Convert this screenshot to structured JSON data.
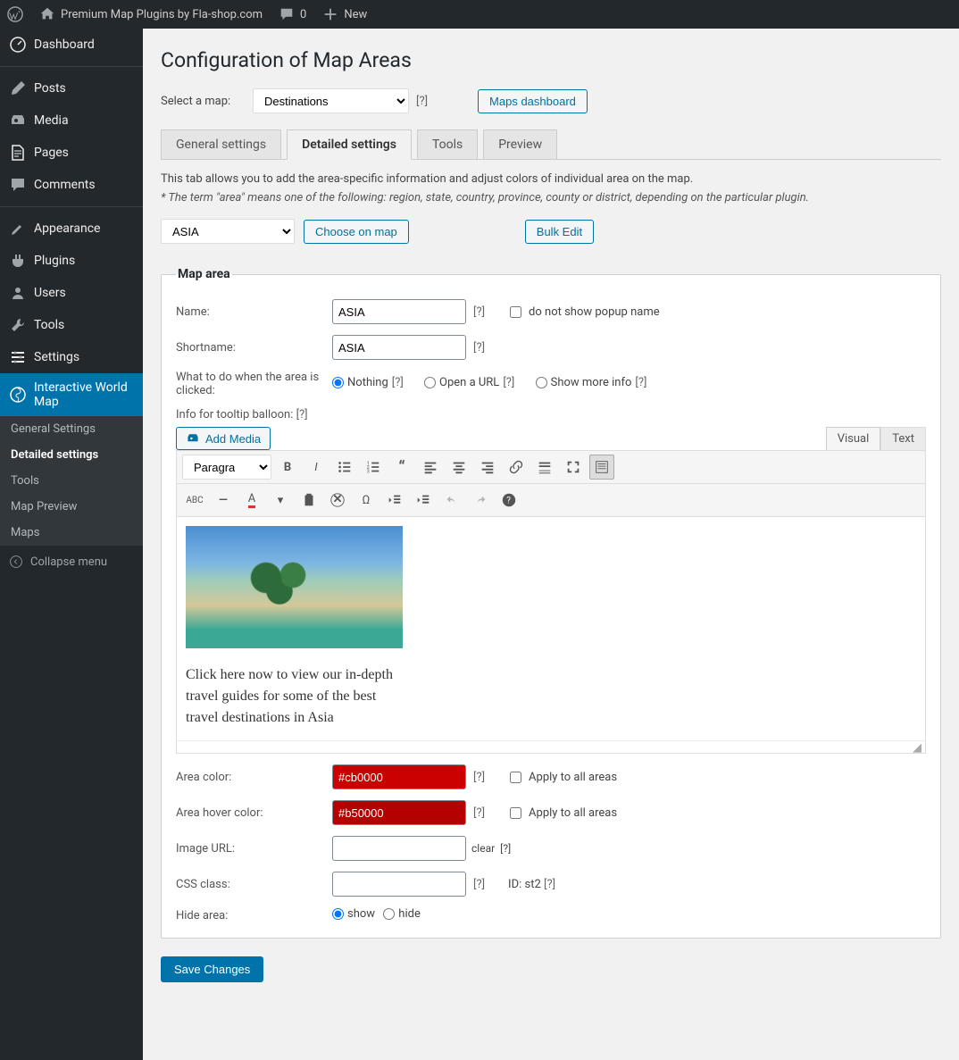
{
  "topbar": {
    "site_title": "Premium Map Plugins by Fla-shop.com",
    "comments": "0",
    "new": "New"
  },
  "sidebar": {
    "items": [
      {
        "label": "Dashboard"
      },
      {
        "label": "Posts"
      },
      {
        "label": "Media"
      },
      {
        "label": "Pages"
      },
      {
        "label": "Comments"
      },
      {
        "label": "Appearance"
      },
      {
        "label": "Plugins"
      },
      {
        "label": "Users"
      },
      {
        "label": "Tools"
      },
      {
        "label": "Settings"
      },
      {
        "label": "Interactive World Map"
      }
    ],
    "submenu": [
      "General Settings",
      "Detailed settings",
      "Tools",
      "Map Preview",
      "Maps"
    ],
    "collapse": "Collapse menu"
  },
  "page": {
    "title": "Configuration of Map Areas",
    "select_label": "Select a map:",
    "select_value": "Destinations",
    "maps_dashboard": "Maps dashboard",
    "tabs": [
      "General settings",
      "Detailed settings",
      "Tools",
      "Preview"
    ],
    "tab_desc": "This tab allows you to add the area-specific information and adjust colors of individual area on the map.",
    "tab_note": "* The term \"area\" means one of the following: region, state, country, province, county or district, depending on the particular plugin.",
    "area_select": "ASIA",
    "choose_on_map": "Choose on map",
    "bulk_edit": "Bulk Edit"
  },
  "form": {
    "legend": "Map area",
    "name_label": "Name:",
    "name_value": "ASIA",
    "name_checkbox": "do not show popup name",
    "shortname_label": "Shortname:",
    "shortname_value": "ASIA",
    "click_label": "What to do when the area is clicked:",
    "click_options": [
      "Nothing",
      "Open a URL",
      "Show more info"
    ],
    "info_label": "Info for tooltip balloon:",
    "add_media": "Add Media",
    "editor_tabs": [
      "Visual",
      "Text"
    ],
    "paragraph": "Paragraph",
    "content_text": "Click here now to view our in-depth travel guides for some of the best travel destinations in Asia",
    "area_color_label": "Area color:",
    "area_color_value": "#cb0000",
    "hover_color_label": "Area hover color:",
    "hover_color_value": "#b50000",
    "apply_all": "Apply to all areas",
    "image_url_label": "Image URL:",
    "clear": "clear",
    "css_label": "CSS class:",
    "id_label": "ID: st2",
    "hide_label": "Hide area:",
    "hide_options": [
      "show",
      "hide"
    ],
    "save": "Save Changes"
  },
  "help_symbol": "[?]"
}
